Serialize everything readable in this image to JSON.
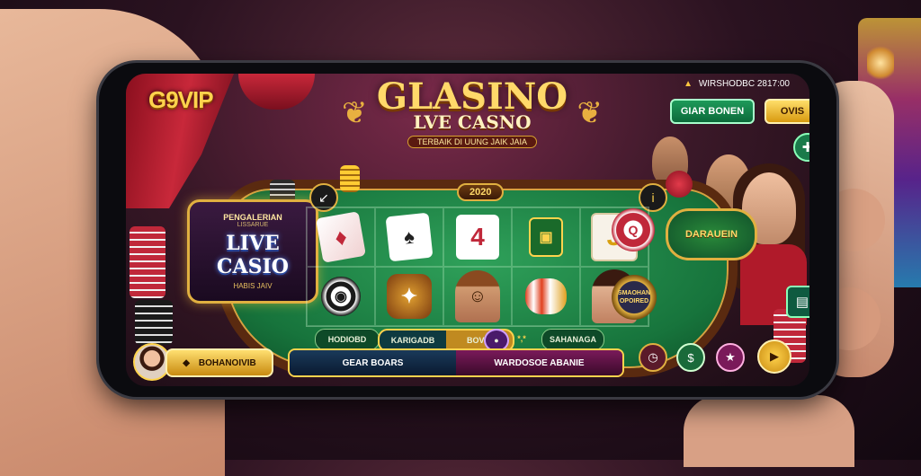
{
  "brand": {
    "logo": "G9VIP"
  },
  "hero": {
    "title": "GLASINO",
    "subtitle": "LVE CASNO",
    "tagline": "TERBAIK DI UUNG JAIK JAIA"
  },
  "status_bar": {
    "text": "WIRSHODBC 2817:00"
  },
  "header_buttons": {
    "primary": "GIAR BONEN",
    "secondary": "OVIS"
  },
  "live_badge": {
    "top": "PENGALERIAN",
    "top_small": "LISSARUE",
    "main": "LIVE CASIO",
    "sub": "HABIS JAIV"
  },
  "year_badge": "2020",
  "dealer_badge": "DARAUEIN",
  "embossed_game": "SMAOHAN OPOIRED",
  "table_tabs": {
    "left": "HODIOBD",
    "center_left": "KARIGADB",
    "center_right": "BOVIE",
    "dots": "*,*",
    "right": "SAHANAGA"
  },
  "player": {
    "button_label": "BOHANOIVIB"
  },
  "bottom_actions": {
    "left": "GEAR BOARS",
    "right": "WARDOSOE ABANIE"
  },
  "icons": {
    "gift": "gift-icon",
    "chat": "chat-icon",
    "back": "back-arrow-icon",
    "info": "info-icon",
    "trophy": "trophy-icon",
    "chevron": "chevron-left-icon",
    "clock": "clock-icon",
    "coin": "coin-icon",
    "star": "star-icon",
    "settings": "settings-icon"
  },
  "colors": {
    "gold": "#ffd34d",
    "table_green": "#17743c",
    "felt_border": "#5a2a10",
    "accent_red": "#c0283a"
  }
}
